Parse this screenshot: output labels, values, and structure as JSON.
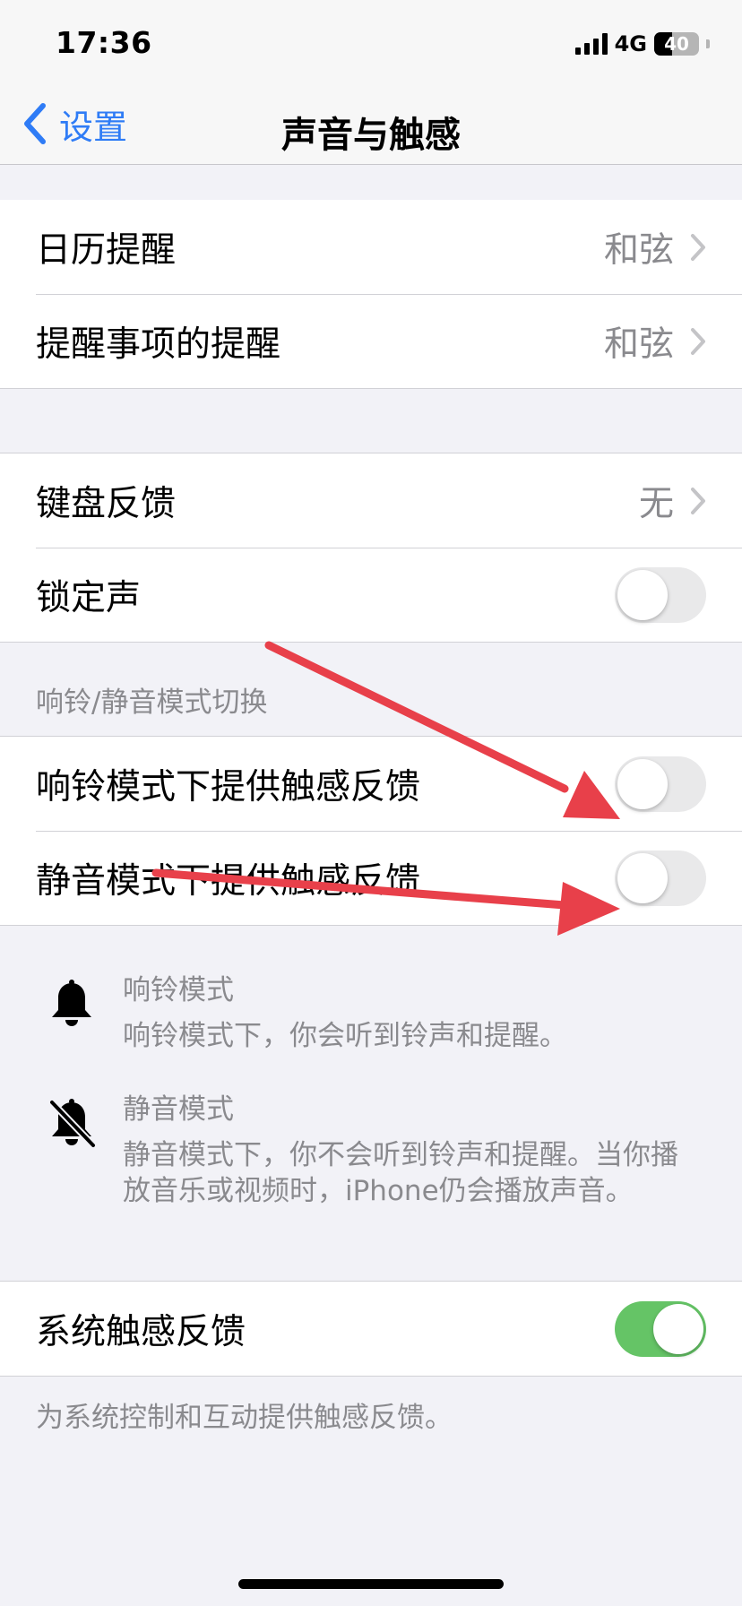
{
  "status_bar": {
    "time": "17:36",
    "network": "4G",
    "battery": "40"
  },
  "nav": {
    "back_label": "设置",
    "title": "声音与触感"
  },
  "group_alerts": [
    {
      "label": "日历提醒",
      "value": "和弦"
    },
    {
      "label": "提醒事项的提醒",
      "value": "和弦"
    }
  ],
  "group_keyboard": {
    "keyboard_feedback": {
      "label": "键盘反馈",
      "value": "无"
    },
    "lock_sound": {
      "label": "锁定声",
      "on": false
    }
  },
  "ring_silent": {
    "header": "响铃/静音模式切换",
    "ring_haptics": {
      "label": "响铃模式下提供触感反馈",
      "on": false
    },
    "silent_haptics": {
      "label": "静音模式下提供触感反馈",
      "on": false
    }
  },
  "info": {
    "ring": {
      "icon": "bell-icon",
      "title": "响铃模式",
      "desc": "响铃模式下，你会听到铃声和提醒。"
    },
    "silent": {
      "icon": "bell-slash-icon",
      "title": "静音模式",
      "desc": "静音模式下，你不会听到铃声和提醒。当你播放音乐或视频时，iPhone仍会播放声音。"
    }
  },
  "system_haptics": {
    "label": "系统触感反馈",
    "on": true,
    "footer": "为系统控制和互动提供触感反馈。"
  },
  "colors": {
    "accent": "#2f7cf6",
    "toggle_on": "#65c466",
    "annotation_arrow": "#e8404a"
  }
}
